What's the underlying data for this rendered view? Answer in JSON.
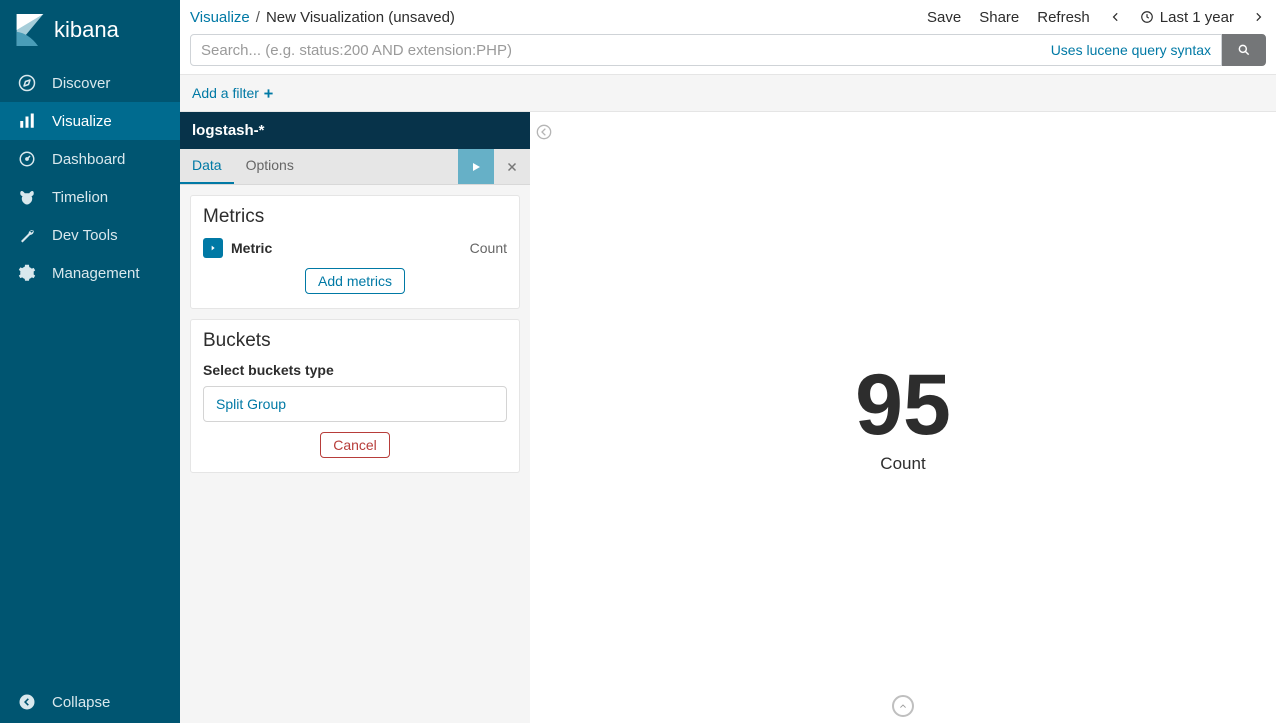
{
  "brand": {
    "title": "kibana"
  },
  "sidebar": {
    "items": [
      {
        "label": "Discover"
      },
      {
        "label": "Visualize"
      },
      {
        "label": "Dashboard"
      },
      {
        "label": "Timelion"
      },
      {
        "label": "Dev Tools"
      },
      {
        "label": "Management"
      }
    ],
    "collapse": "Collapse"
  },
  "breadcrumb": {
    "root": "Visualize",
    "current": "New Visualization (unsaved)"
  },
  "topActions": {
    "save": "Save",
    "share": "Share",
    "refresh": "Refresh",
    "timeRange": "Last 1 year"
  },
  "search": {
    "placeholder": "Search... (e.g. status:200 AND extension:PHP)",
    "hint": "Uses lucene query syntax"
  },
  "filter": {
    "addLabel": "Add a filter"
  },
  "config": {
    "indexPattern": "logstash-*",
    "tabs": {
      "data": "Data",
      "options": "Options"
    },
    "metrics": {
      "title": "Metrics",
      "rowLabel": "Metric",
      "rowType": "Count",
      "addButton": "Add metrics"
    },
    "buckets": {
      "title": "Buckets",
      "subtitle": "Select buckets type",
      "option": "Split Group",
      "cancel": "Cancel"
    }
  },
  "viz": {
    "value": "95",
    "label": "Count"
  }
}
